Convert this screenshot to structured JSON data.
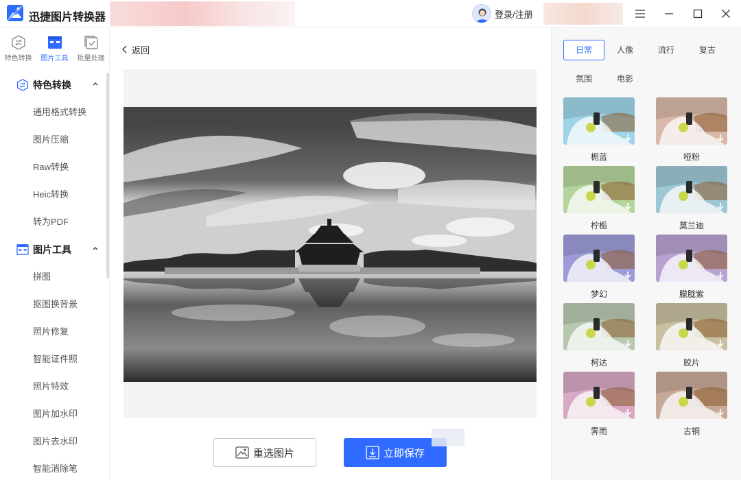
{
  "app": {
    "title": "迅捷图片转换器",
    "login_label": "登录/注册"
  },
  "tool_tabs": [
    {
      "label": "特色转换",
      "icon": "convert-icon",
      "active": false
    },
    {
      "label": "图片工具",
      "icon": "image-tools-icon",
      "active": true
    },
    {
      "label": "批量处理",
      "icon": "batch-icon",
      "active": false
    }
  ],
  "menu": {
    "section1": {
      "label": "特色转换",
      "icon": "convert-icon",
      "items": [
        "通用格式转换",
        "图片压缩",
        "Raw转换",
        "Heic转换",
        "转为PDF"
      ]
    },
    "section2": {
      "label": "图片工具",
      "icon": "image-tools-icon",
      "items": [
        "拼图",
        "抠图换背景",
        "照片修复",
        "智能证件照",
        "照片特效",
        "图片加水印",
        "图片去水印",
        "智能消除笔"
      ]
    }
  },
  "center": {
    "back_label": "返回",
    "reselect_label": "重选图片",
    "save_label": "立即保存"
  },
  "filters": {
    "tabs": [
      "日常",
      "人像",
      "流行",
      "复古",
      "氛围",
      "电影"
    ],
    "active_tab": "日常",
    "items": [
      {
        "label": "栀蓝",
        "tint": "#9fd4e8"
      },
      {
        "label": "哑粉",
        "tint": "#d8b8a8"
      },
      {
        "label": "柠栀",
        "tint": "#b4d49c"
      },
      {
        "label": "莫兰迪",
        "tint": "#9ec7d4"
      },
      {
        "label": "梦幻",
        "tint": "#9d9cd8"
      },
      {
        "label": "朦胧紫",
        "tint": "#b8a2d0"
      },
      {
        "label": "柯达",
        "tint": "#b8c8b0"
      },
      {
        "label": "胶片",
        "tint": "#c8c0a0"
      },
      {
        "label": "霁雨",
        "tint": "#d8a8c4"
      },
      {
        "label": "古铜",
        "tint": "#c8a898"
      }
    ]
  },
  "colors": {
    "accent": "#2f6bff"
  }
}
